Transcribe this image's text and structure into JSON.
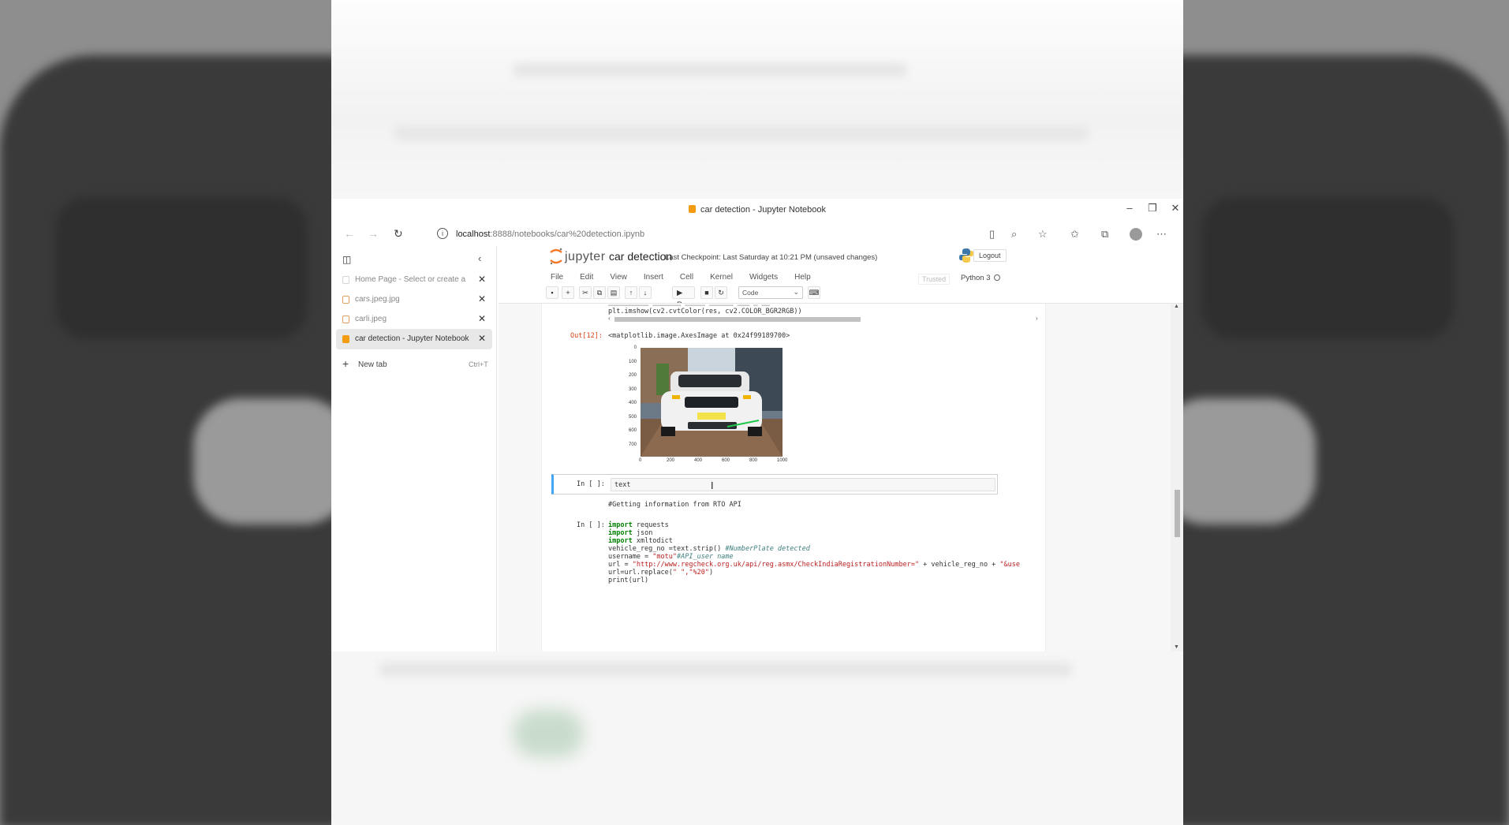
{
  "window": {
    "title": "car detection - Jupyter Notebook",
    "url_host": "localhost",
    "url_path": ":8888/notebooks/car%20detection.ipynb"
  },
  "tabs_panel": {
    "tabs": [
      {
        "label": "Home Page - Select or create a",
        "fav": "blank",
        "active": false
      },
      {
        "label": "cars.jpeg.jpg",
        "fav": "outline",
        "active": false
      },
      {
        "label": "carli.jpeg",
        "fav": "outline",
        "active": false
      },
      {
        "label": "car detection - Jupyter Notebook",
        "fav": "filled",
        "active": true
      }
    ],
    "new_tab_label": "New tab",
    "new_tab_shortcut": "Ctrl+T"
  },
  "jupyter": {
    "logo_text": "jupyter",
    "notebook_name": "car detection",
    "checkpoint": "Last Checkpoint: Last Saturday at 10:21 PM",
    "unsaved": "(unsaved changes)",
    "logout": "Logout",
    "menu": [
      "File",
      "Edit",
      "View",
      "Insert",
      "Cell",
      "Kernel",
      "Widgets",
      "Help"
    ],
    "trusted": "Trusted",
    "kernel": "Python 3",
    "toolbar": {
      "run_label": "Run",
      "cell_type": "Code"
    }
  },
  "notebook": {
    "code_line_partial": "plt.imshow(cv2.cvtColor(res, cv2.COLOR_BGR2RGB))",
    "out_prompt": "Out[12]:",
    "out_text": "<matplotlib.image.AxesImage at 0x24f99189700>",
    "plot": {
      "y_ticks": [
        "0",
        "100",
        "200",
        "300",
        "400",
        "500",
        "600",
        "700"
      ],
      "x_ticks": [
        "0",
        "200",
        "400",
        "600",
        "800",
        "1000"
      ]
    },
    "cell_selected": {
      "prompt": "In [ ]:",
      "code": "text"
    },
    "markdown_text": "#Getting information from RTO API",
    "cell3": {
      "prompt": "In [ ]:",
      "lines": [
        {
          "kw": "import",
          "rest": " requests"
        },
        {
          "kw": "import",
          "rest": " json"
        },
        {
          "kw": "import",
          "rest": " xmltodict"
        }
      ],
      "line4_code": "vehicle_reg_no =text.strip() ",
      "line4_comment": "#NumberPlate detected",
      "line5_code": "username = ",
      "line5_str": "\"motu\"",
      "line5_comment": "#API_user name",
      "line6_code": "url = ",
      "line6_str": "\"http://www.regcheck.org.uk/api/reg.asmx/CheckIndiaRegistrationNumber=\"",
      "line6_tail": " + vehicle_reg_no + ",
      "line6_str2": "\"&use",
      "line7_code": "url=url.replace(",
      "line7_str": "\" \",\"%20\"",
      "line7_end": ")",
      "line8_code": "print(url)"
    }
  }
}
